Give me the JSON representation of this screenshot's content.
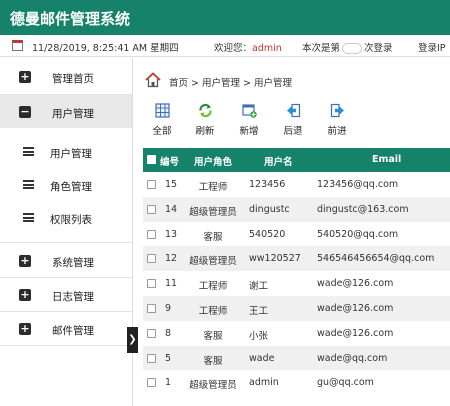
{
  "app": {
    "title": "德曼邮件管理系统"
  },
  "infobar": {
    "datetime": "11/28/2019, 8:25:41 AM 星期四",
    "welcome_prefix": "欢迎您：",
    "username": "admin",
    "visit_prefix": "本次是第",
    "visit_suffix": "次登录",
    "ip_label": "登录IP"
  },
  "sidebar": {
    "items": [
      {
        "label": "管理首页",
        "sign": "+"
      },
      {
        "label": "用户管理",
        "sign": "−"
      },
      {
        "label": "用户管理"
      },
      {
        "label": "角色管理"
      },
      {
        "label": "权限列表"
      },
      {
        "label": "系统管理",
        "sign": "+"
      },
      {
        "label": "日志管理",
        "sign": "+"
      },
      {
        "label": "邮件管理",
        "sign": "+"
      }
    ],
    "collapse_glyph": "❯"
  },
  "breadcrumb": {
    "text": "首页 > 用户管理 > 用户管理"
  },
  "toolbar": {
    "all": "全部",
    "refresh": "刷新",
    "add": "新增",
    "back": "后退",
    "forward": "前进"
  },
  "table": {
    "headers": {
      "id": "编号",
      "role": "用户角色",
      "name": "用户名",
      "email": "Email"
    },
    "rows": [
      {
        "id": "15",
        "role": "工程师",
        "name": "123456",
        "email": "123456@qq.com"
      },
      {
        "id": "14",
        "role": "超级管理员",
        "name": "dingustc",
        "email": "dingustc@163.com"
      },
      {
        "id": "13",
        "role": "客服",
        "name": "540520",
        "email": "540520@qq.com"
      },
      {
        "id": "12",
        "role": "超级管理员",
        "name": "ww120527",
        "email": "546546456654@qq.com"
      },
      {
        "id": "11",
        "role": "工程师",
        "name": "谢工",
        "email": "wade@126.com"
      },
      {
        "id": "9",
        "role": "工程师",
        "name": "王工",
        "email": "wade@126.com"
      },
      {
        "id": "8",
        "role": "客服",
        "name": "小张",
        "email": "wade@126.com"
      },
      {
        "id": "5",
        "role": "客服",
        "name": "wade",
        "email": "wade@qq.com"
      },
      {
        "id": "1",
        "role": "超级管理员",
        "name": "admin",
        "email": "gu@qq.com"
      }
    ]
  },
  "colors": {
    "brand": "#17826a",
    "accent": "#c0392b"
  }
}
